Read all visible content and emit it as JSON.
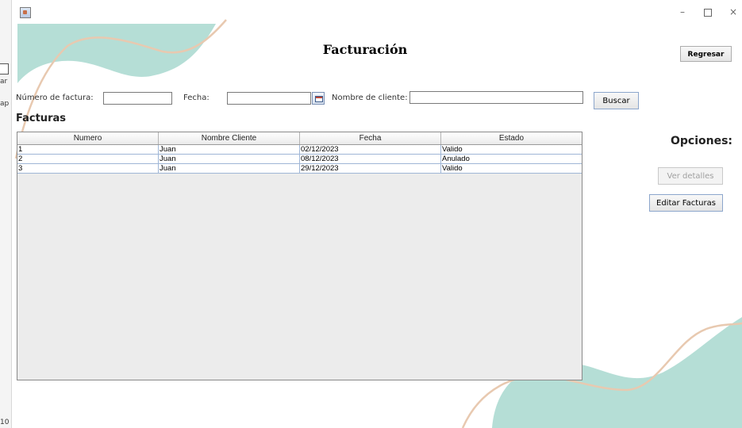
{
  "edge_strip": {
    "fragments": [
      "ar",
      "ap",
      "10"
    ]
  },
  "window": {
    "icon": "java-cup-icon",
    "controls": {
      "minimize": "–",
      "close": "×"
    }
  },
  "header": {
    "title": "Facturación",
    "back_button": "Regresar"
  },
  "search": {
    "invoice_number_label": "Número de factura:",
    "invoice_number_value": "",
    "date_label": "Fecha:",
    "date_value": "",
    "client_name_label": "Nombre de cliente:",
    "client_name_value": "",
    "search_button": "Buscar"
  },
  "invoices": {
    "section_title": "Facturas",
    "columns": [
      "Numero",
      "Nombre Cliente",
      "Fecha",
      "Estado"
    ],
    "rows": [
      [
        "1",
        "Juan",
        "02/12/2023",
        "Valido"
      ],
      [
        "2",
        "Juan",
        "08/12/2023",
        "Anulado"
      ],
      [
        "3",
        "Juan",
        "29/12/2023",
        "Valido"
      ]
    ]
  },
  "options": {
    "title": "Opciones:",
    "view_details_button": "Ver detalles",
    "edit_button": "Editar Facturas"
  },
  "colors": {
    "teal_shape": "#b5ded6",
    "tan_line": "#e8c9b0"
  }
}
